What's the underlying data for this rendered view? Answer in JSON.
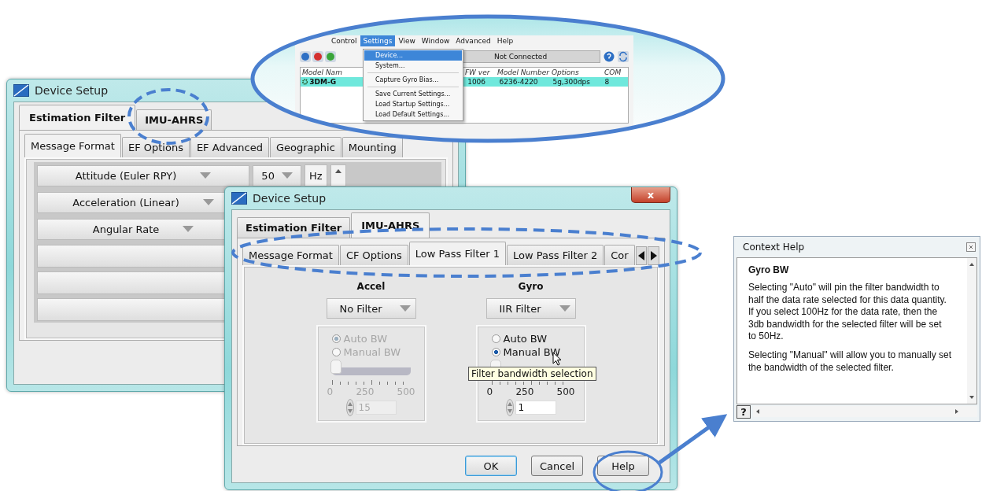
{
  "app_window": {
    "menu_bar": [
      {
        "label": "Control",
        "selected": false
      },
      {
        "label": "Settings",
        "selected": true
      },
      {
        "label": "View",
        "selected": false
      },
      {
        "label": "Window",
        "selected": false
      },
      {
        "label": "Advanced",
        "selected": false
      },
      {
        "label": "Help",
        "selected": false
      }
    ],
    "settings_menu": {
      "groups": [
        [
          {
            "label": "Device...",
            "selected": true
          },
          {
            "label": "System...",
            "selected": false
          }
        ],
        [
          {
            "label": "Capture Gyro Bias...",
            "selected": false
          }
        ],
        [
          {
            "label": "Save Current Settings...",
            "selected": false
          },
          {
            "label": "Load Startup Settings...",
            "selected": false
          },
          {
            "label": "Load Default Settings...",
            "selected": false
          }
        ]
      ]
    },
    "status": "Not Connected",
    "device_table": {
      "columns": [
        "Model Nam",
        "FW ver",
        "Model Number",
        "Options",
        "COM"
      ],
      "rows": [
        {
          "cells": [
            "3DM-G",
            "1006",
            "6236-4220",
            "5g,300dps",
            "8"
          ],
          "selected": true
        }
      ]
    }
  },
  "back_dialog": {
    "title": "Device Setup",
    "tabs": [
      {
        "label": "Estimation Filter",
        "selected": true
      },
      {
        "label": "IMU-AHRS",
        "selected": false
      }
    ],
    "subtabs": [
      {
        "label": "Message Format",
        "selected": true
      },
      {
        "label": "EF Options",
        "selected": false
      },
      {
        "label": "EF Advanced",
        "selected": false
      },
      {
        "label": "Geographic",
        "selected": false
      },
      {
        "label": "Mounting",
        "selected": false
      }
    ],
    "rows": [
      {
        "label": "Attitude (Euler RPY)",
        "rate": "50",
        "unit": "Hz"
      },
      {
        "label": "Acceleration (Linear)"
      },
      {
        "label": "Angular Rate"
      },
      {},
      {},
      {}
    ]
  },
  "front_dialog": {
    "title": "Device Setup",
    "close": "x",
    "tabs": [
      {
        "label": "Estimation Filter",
        "selected": false
      },
      {
        "label": "IMU-AHRS",
        "selected": true
      }
    ],
    "subtabs": [
      {
        "label": "Message Format",
        "selected": false
      },
      {
        "label": "CF Options",
        "selected": false
      },
      {
        "label": "Low Pass Filter 1",
        "selected": true
      },
      {
        "label": "Low Pass Filter 2",
        "selected": false
      },
      {
        "label": "Cor",
        "selected": false
      }
    ],
    "columns": [
      {
        "heading": "Accel",
        "filter": "No Filter",
        "disabled": true,
        "radios": [
          {
            "label": "Auto BW",
            "checked": true
          },
          {
            "label": "Manual BW",
            "checked": false
          }
        ],
        "level": 0,
        "ticks": [
          "0",
          "250",
          "500"
        ],
        "value": "15"
      },
      {
        "heading": "Gyro",
        "filter": "IIR Filter",
        "disabled": false,
        "radios": [
          {
            "label": "Auto BW",
            "checked": false
          },
          {
            "label": "Manual BW",
            "checked": true
          }
        ],
        "level": 0,
        "ticks": [
          "0",
          "250",
          "500"
        ],
        "value": "1"
      }
    ],
    "tooltip": "Filter bandwidth selection",
    "buttons": [
      {
        "label": "OK",
        "default": true
      },
      {
        "label": "Cancel",
        "default": false
      },
      {
        "label": "Help",
        "default": false
      }
    ]
  },
  "context_help": {
    "title": "Context Help",
    "heading": "Gyro BW",
    "paragraphs": [
      "Selecting \"Auto\" will pin the filter bandwidth to half the data rate selected for this data quantity.  If you select 100Hz for the data rate, then the 3db bandwidth for the selected filter will be set to  50Hz.",
      "Selecting \"Manual\" will allow you to manually set the bandwidth of the selected filter."
    ],
    "help_button": "?"
  }
}
